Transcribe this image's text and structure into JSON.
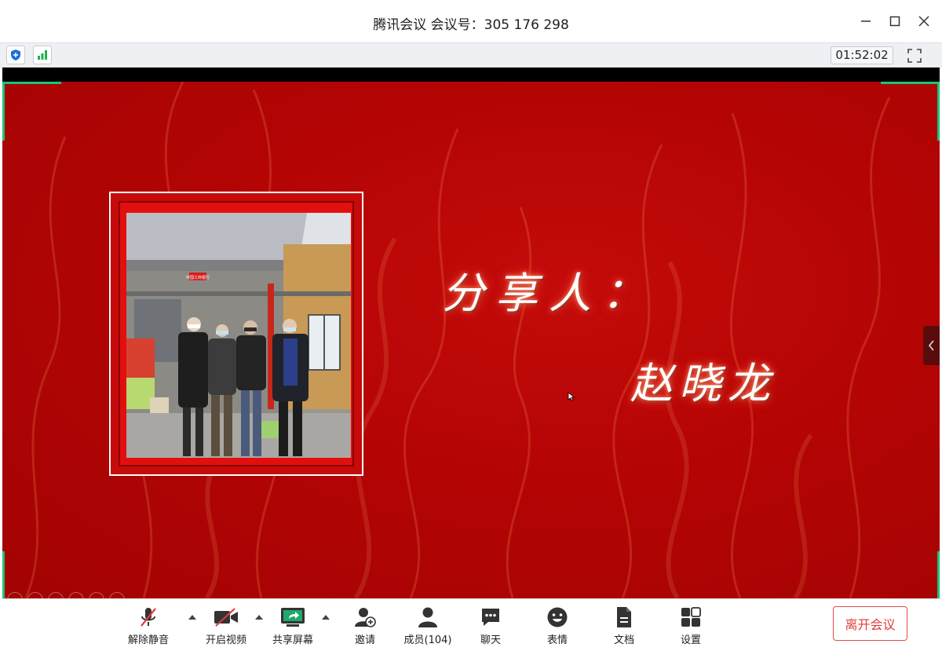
{
  "window": {
    "title": "腾讯会议 会议号：305 176 298",
    "minimize_glyph": "—",
    "maximize_glyph": "☐",
    "close_glyph": "✕"
  },
  "status": {
    "shield_icon": "shield-icon",
    "signal_icon": "signal-icon",
    "timer": "01:52:02",
    "fullscreen_icon": "fullscreen-icon"
  },
  "slide": {
    "caption_line1": "分享人：",
    "caption_line2": "赵晓龙",
    "photo_sign": "中国工商银行"
  },
  "toolbar": {
    "mute": "解除静音",
    "video": "开启视频",
    "share": "共享屏幕",
    "invite": "邀请",
    "members": "成员(104)",
    "chat": "聊天",
    "emoji": "表情",
    "docs": "文档",
    "settings": "设置",
    "leave": "离开会议"
  },
  "colors": {
    "accent_green": "#1ec27a",
    "slide_red": "#b40404",
    "leave_red": "#e23b3b"
  }
}
